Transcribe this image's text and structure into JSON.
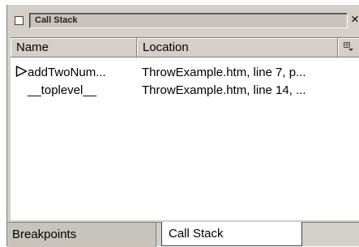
{
  "window": {
    "title": "Call Stack",
    "close_glyph": "×"
  },
  "columns": {
    "name": "Name",
    "location": "Location",
    "chooser_icon": "column-chooser-icon"
  },
  "rows": [
    {
      "name": "addTwoNum...",
      "location": "ThrowExample.htm, line 7, p...",
      "current": true,
      "icon": "current-frame-arrow-icon"
    },
    {
      "name": "__toplevel__",
      "location": "ThrowExample.htm, line 14, ...",
      "current": false
    }
  ],
  "tabs": {
    "breakpoints": "Breakpoints",
    "callstack": "Call Stack",
    "active": "callstack"
  },
  "colors": {
    "panel": "#d4d0c8",
    "list": "#ffffff"
  }
}
